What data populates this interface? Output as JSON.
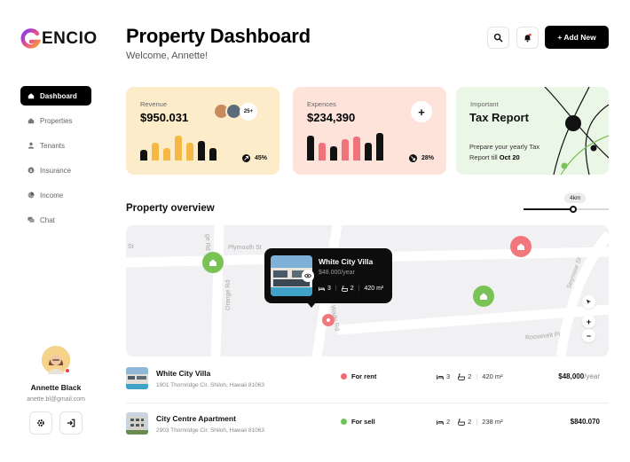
{
  "brand": {
    "name": "ENCIO"
  },
  "sidebar": {
    "items": [
      {
        "label": "Dashboard",
        "icon": "home-icon",
        "active": true
      },
      {
        "label": "Properties",
        "icon": "building-icon"
      },
      {
        "label": "Tenants",
        "icon": "user-icon"
      },
      {
        "label": "Insurance",
        "icon": "dollar-icon"
      },
      {
        "label": "Income",
        "icon": "pie-chart-icon"
      },
      {
        "label": "Chat",
        "icon": "chat-icon"
      }
    ]
  },
  "profile": {
    "name": "Annette Black",
    "email": "anette.bl@gmail.com"
  },
  "header": {
    "title": "Property Dashboard",
    "welcome": "Welcome, Annette!",
    "add_label": "+ Add New"
  },
  "cards": {
    "revenue": {
      "label": "Revenue",
      "value": "$950.031",
      "change": "45%",
      "avatars_more": "25+"
    },
    "expenses": {
      "label": "Expences",
      "value": "$234,390",
      "change": "28%"
    },
    "tax": {
      "label": "Important",
      "title": "Tax Report",
      "desc_prefix": "Prepare your yearly Tax Report till",
      "deadline": "Oct 20"
    }
  },
  "overview": {
    "title": "Property overview",
    "distance": "4km",
    "streets": [
      "Plymouth St",
      "St",
      "Orange Rd",
      "Wade Rd",
      "Seymour St",
      "Roosevelt Pl"
    ]
  },
  "popup": {
    "title": "White City Villa",
    "price": "$48.000",
    "per": "/year",
    "beds": "3",
    "baths": "2",
    "area": "420 m²"
  },
  "listings": [
    {
      "name": "White City Villa",
      "address": "1901 Thornridge Cir. Shiloh, Hawaii 81063",
      "status": "For rent",
      "status_color": "#f06a72",
      "beds": "3",
      "baths": "2",
      "area": "420 m²",
      "price": "$48,000",
      "per": "/year"
    },
    {
      "name": "City Centre Apartment",
      "address": "2903 Thornridge Cir. Shiloh, Hawaii 81063",
      "status": "For sell",
      "status_color": "#6ec25a",
      "beds": "2",
      "baths": "2",
      "area": "238 m²",
      "price": "$840.070",
      "per": ""
    }
  ],
  "colors": {
    "accent_dark": "#000000",
    "revenue_bg": "#fdecc9",
    "expense_bg": "#fde3da",
    "tax_bg": "#eaf6e6",
    "pin_green": "#79c255",
    "pin_red": "#f2777c"
  }
}
